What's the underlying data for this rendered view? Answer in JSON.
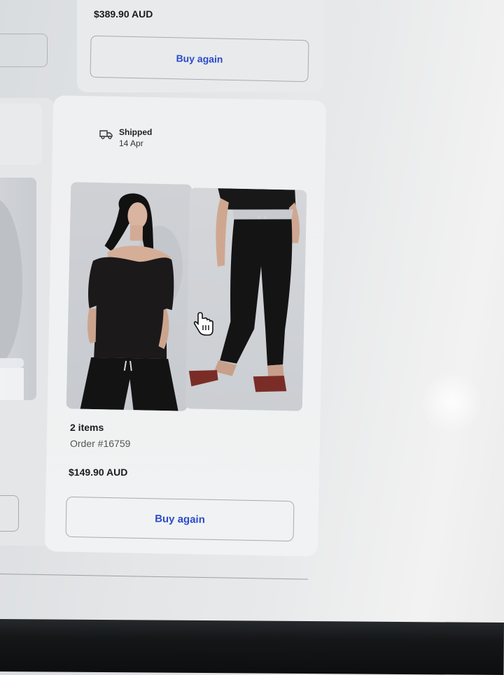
{
  "previous_order": {
    "price": "$389.90 AUD",
    "buy_again_label": "Buy again"
  },
  "order": {
    "status": "Shipped",
    "status_date": "14 Apr",
    "items_count": "2 items",
    "order_number": "Order #16759",
    "price": "$149.90 AUD",
    "buy_again_label": "Buy again",
    "status_icon": "truck-icon",
    "products": [
      {
        "kind": "top",
        "icon": "product-image"
      },
      {
        "kind": "pants",
        "icon": "product-image"
      }
    ]
  },
  "colors": {
    "accent": "#2a4bc9",
    "card": "#eff0f1",
    "bezel": "#141618"
  }
}
